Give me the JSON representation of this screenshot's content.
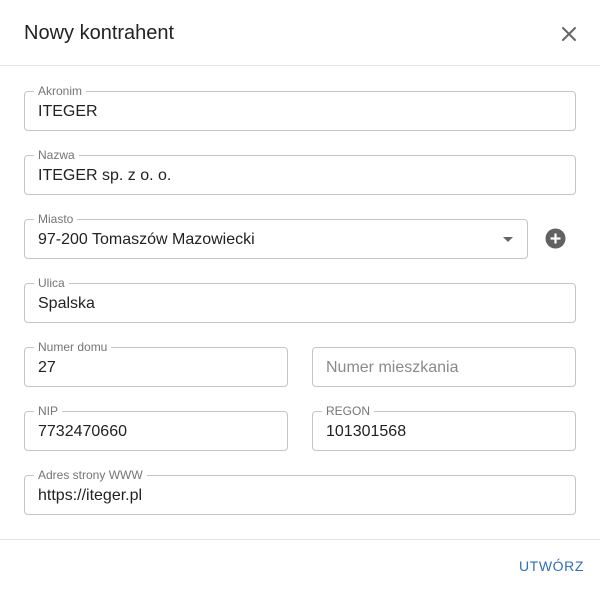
{
  "dialog": {
    "title": "Nowy kontrahent",
    "close_icon": "close-icon"
  },
  "form": {
    "akronim": {
      "label": "Akronim",
      "value": "ITEGER"
    },
    "nazwa": {
      "label": "Nazwa",
      "value": "ITEGER sp. z o. o."
    },
    "miasto": {
      "label": "Miasto",
      "value": "97-200 Tomaszów Mazowiecki"
    },
    "add_city_icon": "add-circle-icon",
    "ulica": {
      "label": "Ulica",
      "value": "Spalska"
    },
    "numer_domu": {
      "label": "Numer domu",
      "value": "27"
    },
    "numer_mieszkania": {
      "placeholder": "Numer mieszkania",
      "value": ""
    },
    "nip": {
      "label": "NIP",
      "value": "7732470660"
    },
    "regon": {
      "label": "REGON",
      "value": "101301568"
    },
    "www": {
      "label": "Adres strony WWW",
      "value": "https://iteger.pl"
    }
  },
  "footer": {
    "create_label": "UTWÓRZ"
  },
  "colors": {
    "accent": "#2f6fbf",
    "border": "#c4c4c4",
    "label": "#757575",
    "text": "#222222"
  }
}
